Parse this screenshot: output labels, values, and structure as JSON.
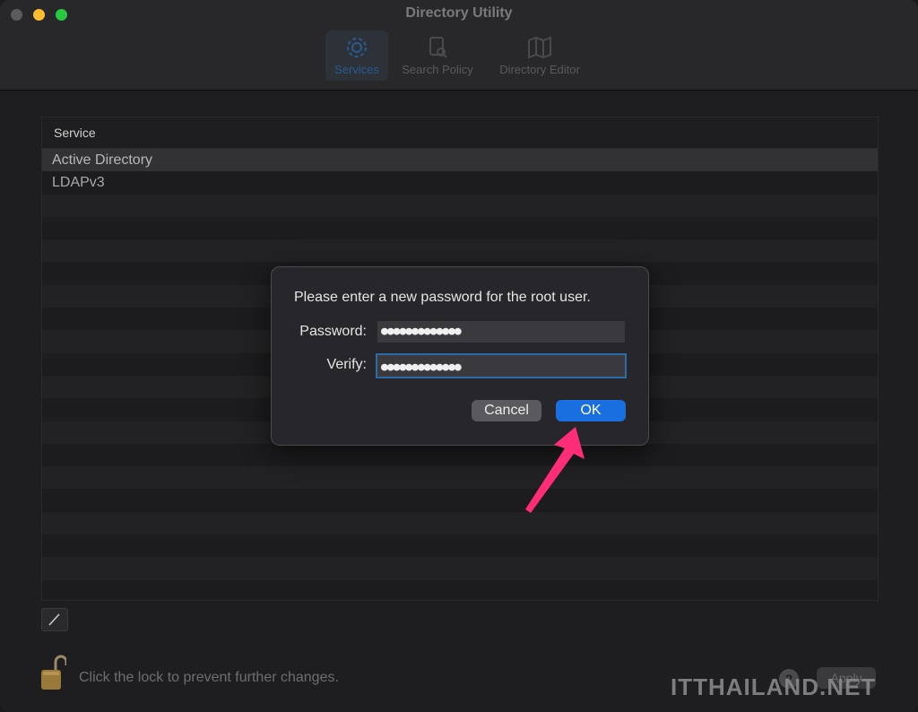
{
  "window": {
    "title": "Directory Utility"
  },
  "toolbar": {
    "items": [
      {
        "label": "Services",
        "icon": "gear-icon",
        "selected": true
      },
      {
        "label": "Search Policy",
        "icon": "document-search-icon",
        "selected": false
      },
      {
        "label": "Directory Editor",
        "icon": "map-icon",
        "selected": false
      }
    ]
  },
  "services_table": {
    "header": "Service",
    "rows": [
      "Active Directory",
      "LDAPv3"
    ],
    "selected_row": "Active Directory"
  },
  "footer": {
    "lock_text": "Click the lock to prevent further changes.",
    "help_label": "?",
    "apply_label": "Apply",
    "watermark": "ITTHAILAND.NET"
  },
  "dialog": {
    "message": "Please enter a new password for the root user.",
    "password_label": "Password:",
    "password_value": "●●●●●●●●●●●●●",
    "verify_label": "Verify:",
    "verify_value": "●●●●●●●●●●●●●",
    "cancel_label": "Cancel",
    "ok_label": "OK"
  },
  "colors": {
    "accent": "#1a6fe0",
    "annotation_arrow": "#ff2d78",
    "focus_ring": "#2d6aa8"
  }
}
